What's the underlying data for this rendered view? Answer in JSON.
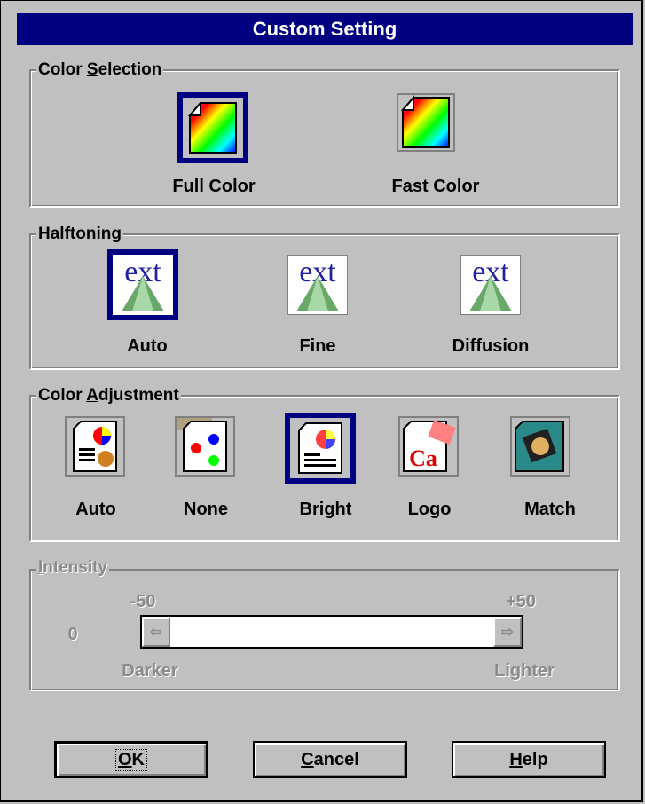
{
  "title": "Custom Setting",
  "color_selection": {
    "legend_pre": "Color ",
    "legend_u": "S",
    "legend_post": "election",
    "options": [
      {
        "label": "Full Color",
        "selected": true
      },
      {
        "label": "Fast Color",
        "selected": false
      }
    ]
  },
  "halftoning": {
    "legend_pre": "Half",
    "legend_u": "t",
    "legend_post": "oning",
    "options": [
      {
        "label": "Auto",
        "selected": true
      },
      {
        "label": "Fine",
        "selected": false
      },
      {
        "label": "Diffusion",
        "selected": false
      }
    ]
  },
  "color_adjustment": {
    "legend_pre": "Color ",
    "legend_u": "A",
    "legend_post": "djustment",
    "options": [
      {
        "label": "Auto",
        "selected": false
      },
      {
        "label": "None",
        "selected": false
      },
      {
        "label": "Bright",
        "selected": true
      },
      {
        "label": "Logo",
        "selected": false
      },
      {
        "label": "Match",
        "selected": false
      }
    ]
  },
  "intensity": {
    "legend_u": "I",
    "legend_post": "ntensity",
    "min_label": "-50",
    "max_label": "+50",
    "value": "0",
    "left_label": "Darker",
    "right_label": "Lighter",
    "left_arrow": "⇦",
    "right_arrow": "⇨"
  },
  "buttons": {
    "ok_u": "O",
    "ok_post": "K",
    "cancel_u": "C",
    "cancel_post": "ancel",
    "help_u": "H",
    "help_post": "elp"
  },
  "colors": {
    "title_bar": "#000080",
    "dialog_bg": "#c0c0c0",
    "selection": "#000080"
  }
}
